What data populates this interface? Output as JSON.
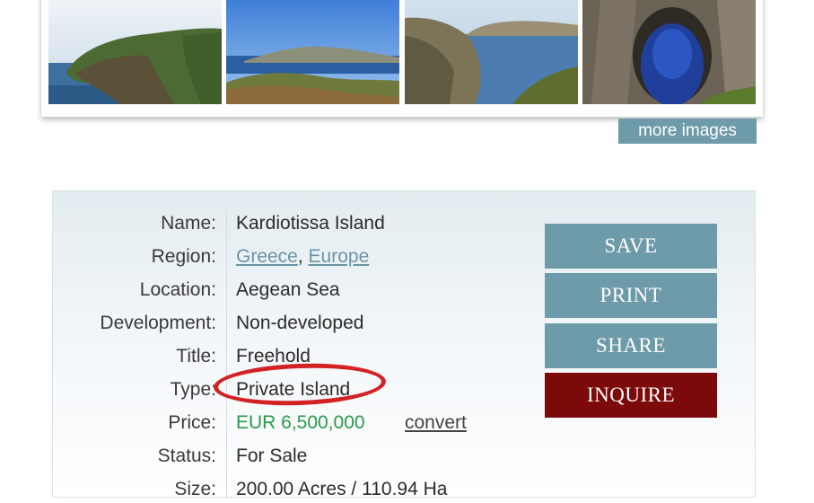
{
  "gallery": {
    "thumbnails": [
      {
        "icon": "coastal-headland-photo"
      },
      {
        "icon": "island-view-photo"
      },
      {
        "icon": "bay-cliffs-photo"
      },
      {
        "icon": "sea-cave-photo"
      }
    ],
    "more_images_label": "more images"
  },
  "details": {
    "rows": [
      {
        "label": "Name:",
        "value": "Kardiotissa Island"
      },
      {
        "label": "Region:",
        "links": [
          "Greece",
          "Europe"
        ],
        "separator": ", "
      },
      {
        "label": "Location:",
        "value": "Aegean Sea"
      },
      {
        "label": "Development:",
        "value": "Non-developed"
      },
      {
        "label": "Title:",
        "value": "Freehold"
      },
      {
        "label": "Type:",
        "value": "Private Island"
      },
      {
        "label": "Price:",
        "value": "EUR 6,500,000",
        "action": "convert"
      },
      {
        "label": "Status:",
        "value": "For Sale"
      },
      {
        "label": "Size:",
        "value": "200.00 Acres / 110.94 Ha"
      }
    ]
  },
  "actions": {
    "save": "SAVE",
    "print": "PRINT",
    "share": "SHARE",
    "inquire": "INQUIRE"
  },
  "colors": {
    "accent": "#6e9ba9",
    "inquire": "#7d0a0a",
    "price": "#2a9a4a",
    "highlight_circle": "#d32224"
  }
}
